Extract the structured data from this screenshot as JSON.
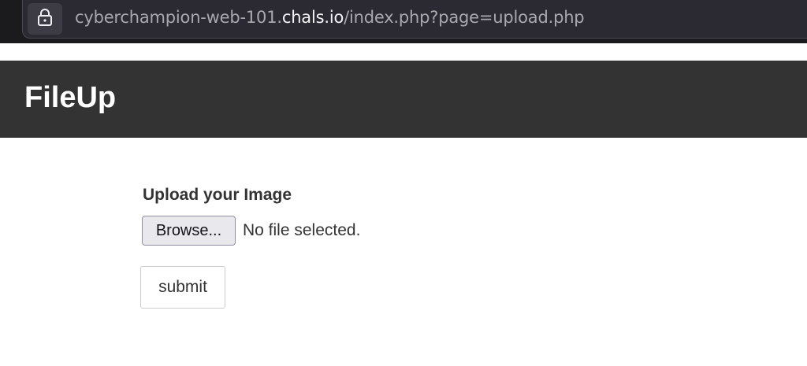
{
  "browser": {
    "url_domain_prefix": "cyberchampion-web-101.",
    "url_domain": "chals.io",
    "url_path": "/index.php?page=upload.php",
    "lock_icon": "lock-icon"
  },
  "header": {
    "title": "FileUp",
    "background_color": "#333333"
  },
  "form": {
    "label": "Upload your Image",
    "browse_label": "Browse...",
    "file_status": "No file selected.",
    "submit_label": "submit"
  }
}
